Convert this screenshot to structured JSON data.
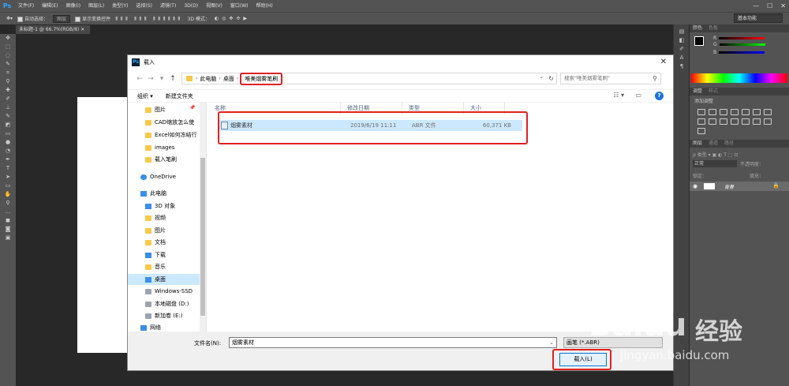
{
  "ps": {
    "logo": "Ps",
    "menus": [
      "文件(F)",
      "编辑(E)",
      "图像(I)",
      "图层(L)",
      "类型(Y)",
      "选择(S)",
      "滤镜(T)",
      "3D(D)",
      "视图(V)",
      "窗口(W)",
      "帮助(H)"
    ],
    "win_min": "—",
    "win_max": "☐",
    "win_close": "✕",
    "options": {
      "auto_select": "自动选择：",
      "auto_select_value": "图层",
      "show_transform": "显示变换控件",
      "mode_3d": "3D 模式："
    },
    "workspace": "基本功能",
    "doc_tab": "未标题-1 @ 66.7%(RGB/8)",
    "panels": {
      "color_tabs": [
        "颜色",
        "色板"
      ],
      "adjust_tabs": [
        "调整",
        "样式"
      ],
      "adjust_add": "添加调整",
      "layers_tabs": [
        "图层",
        "通道",
        "路径"
      ],
      "blend_mode": "正常",
      "opacity_label": "不透明度：",
      "lock_label": "锁定：",
      "fill_label": "填充：",
      "layer_name": "背景"
    }
  },
  "dialog": {
    "title": "载入",
    "close": "✕",
    "breadcrumb": [
      "此电脑",
      "桌面",
      "唯美烟雾笔刷"
    ],
    "search_placeholder": "搜索\"唯美烟雾笔刷\"",
    "organize": "组织 ▾",
    "new_folder": "新建文件夹",
    "help": "?",
    "nav_items": [
      {
        "label": "图片",
        "icon": "folder"
      },
      {
        "label": "CAD缩放怎么使",
        "icon": "folder"
      },
      {
        "label": "Excel如何冻结行",
        "icon": "folder"
      },
      {
        "label": "images",
        "icon": "folder"
      },
      {
        "label": "载入笔刷",
        "icon": "folder"
      },
      {
        "label": "OneDrive",
        "icon": "cloud"
      },
      {
        "label": "此电脑",
        "icon": "pc"
      },
      {
        "label": "3D 对象",
        "icon": "blue"
      },
      {
        "label": "视频",
        "icon": "folder"
      },
      {
        "label": "图片",
        "icon": "folder"
      },
      {
        "label": "文档",
        "icon": "folder"
      },
      {
        "label": "下载",
        "icon": "blue"
      },
      {
        "label": "音乐",
        "icon": "folder"
      },
      {
        "label": "桌面",
        "icon": "blue"
      },
      {
        "label": "Windows-SSD",
        "icon": "drive"
      },
      {
        "label": "本地磁盘 (D:)",
        "icon": "drive"
      },
      {
        "label": "新加卷 (E:)",
        "icon": "drive"
      },
      {
        "label": "网络",
        "icon": "blue"
      }
    ],
    "columns": [
      "名称",
      "修改日期",
      "类型",
      "大小"
    ],
    "files": [
      {
        "name": "烟雾素材",
        "date": "2019/6/19 11:11",
        "type": "ABR 文件",
        "size": "60,371 KB"
      }
    ],
    "filename_label": "文件名(N):",
    "filename_value": "烟雾素材",
    "filter": "画笔 (*.ABR)",
    "load_button": "载入(L)"
  },
  "watermark": {
    "logo": "Baidu",
    "cn": "经验",
    "url": "jingyan.baidu.com"
  },
  "colors": {
    "accent": "#0078d7",
    "highlight": "#e02020",
    "selection": "#cce8ff",
    "ps_bg": "#282828"
  }
}
